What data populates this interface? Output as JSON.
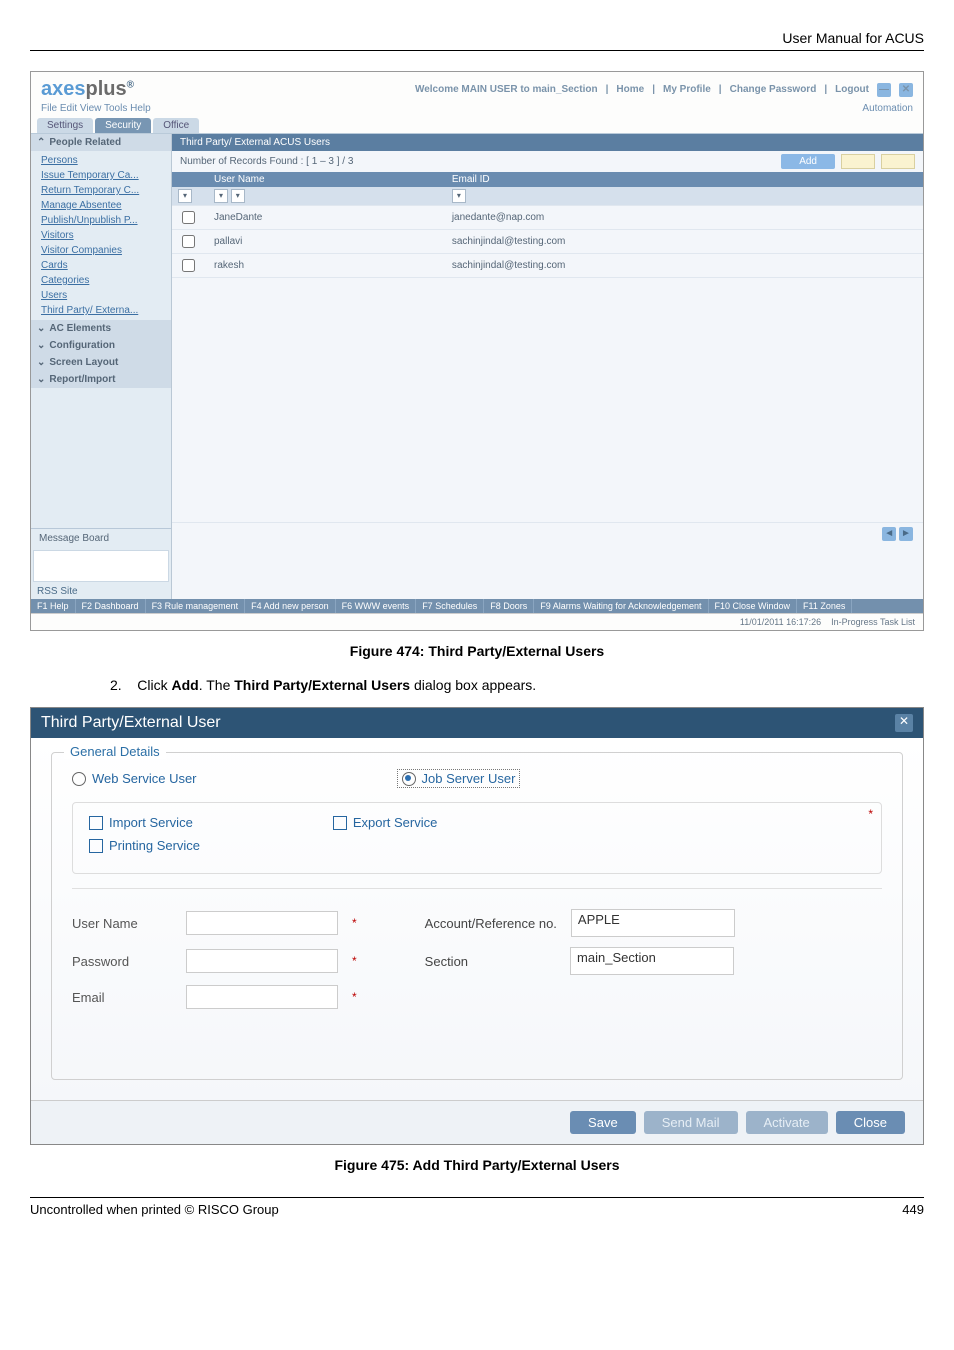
{
  "header": {
    "title": "User Manual for ACUS"
  },
  "screenshot1": {
    "brand": "axesplus",
    "trademark": "®",
    "welcome": "Welcome MAIN USER to main_Section",
    "toplinks": [
      "Home",
      "My Profile",
      "Change Password",
      "Logout"
    ],
    "menu": "File  Edit  View  Tools  Help",
    "automation": "Automation",
    "tabs": [
      "Settings",
      "Security",
      "Office"
    ],
    "sidebar_header": "People Related",
    "sidebar_items": [
      "Persons",
      "Issue Temporary Ca...",
      "Return Temporary C...",
      "Manage Absentee",
      "Publish/Unpublish P...",
      "Visitors",
      "Visitor Companies",
      "Cards",
      "Categories",
      "Users",
      "Third Party/ Externa..."
    ],
    "sidebar_sections": [
      "AC Elements",
      "Configuration",
      "Screen Layout",
      "Report/Import"
    ],
    "panel_title": "Third Party/ External ACUS Users",
    "records": "Number of Records Found : [ 1 – 3 ] / 3",
    "add_btn": "Add",
    "col1": "User Name",
    "col2": "Email ID",
    "rows": [
      {
        "u": "JaneDante",
        "e": "janedante@nap.com"
      },
      {
        "u": "pallavi",
        "e": "sachinjindal@testing.com"
      },
      {
        "u": "rakesh",
        "e": "sachinjindal@testing.com"
      }
    ],
    "msgboard": "Message Board",
    "rss": "RSS Site",
    "statusbar": [
      "F1 Help",
      "F2 Dashboard",
      "F3 Rule management",
      "F4 Add new person",
      "F6 WWW events",
      "F7 Schedules",
      "F8 Doors",
      "F9 Alarms Waiting for Acknowledgement",
      "F10 Close Window",
      "F11 Zones"
    ],
    "timestamp": "11/01/2011 16:17:26",
    "footer_link": "In-Progress  Task List"
  },
  "caption1": "Figure 474: Third Party/External Users",
  "step_num": "2.",
  "step_text_pre": "Click ",
  "step_bold1": "Add",
  "step_mid": ". The ",
  "step_bold2": "Third Party/External Users",
  "step_post": " dialog box appears.",
  "dialog": {
    "title": "Third Party/External User",
    "legend": "General Details",
    "radio1": "Web Service User",
    "radio2": "Job Server User",
    "chk1": "Import Service",
    "chk2": "Export Service",
    "chk3": "Printing Service",
    "username_lbl": "User Name",
    "acct_lbl": "Account/Reference no.",
    "acct_val": "APPLE",
    "password_lbl": "Password",
    "section_lbl": "Section",
    "section_val": "main_Section",
    "email_lbl": "Email",
    "asterisk": "*",
    "btn_save": "Save",
    "btn_send": "Send Mail",
    "btn_activate": "Activate",
    "btn_close": "Close"
  },
  "caption2": "Figure 475: Add Third Party/External Users",
  "footer_left": "Uncontrolled when printed © RISCO Group",
  "footer_right": "449"
}
